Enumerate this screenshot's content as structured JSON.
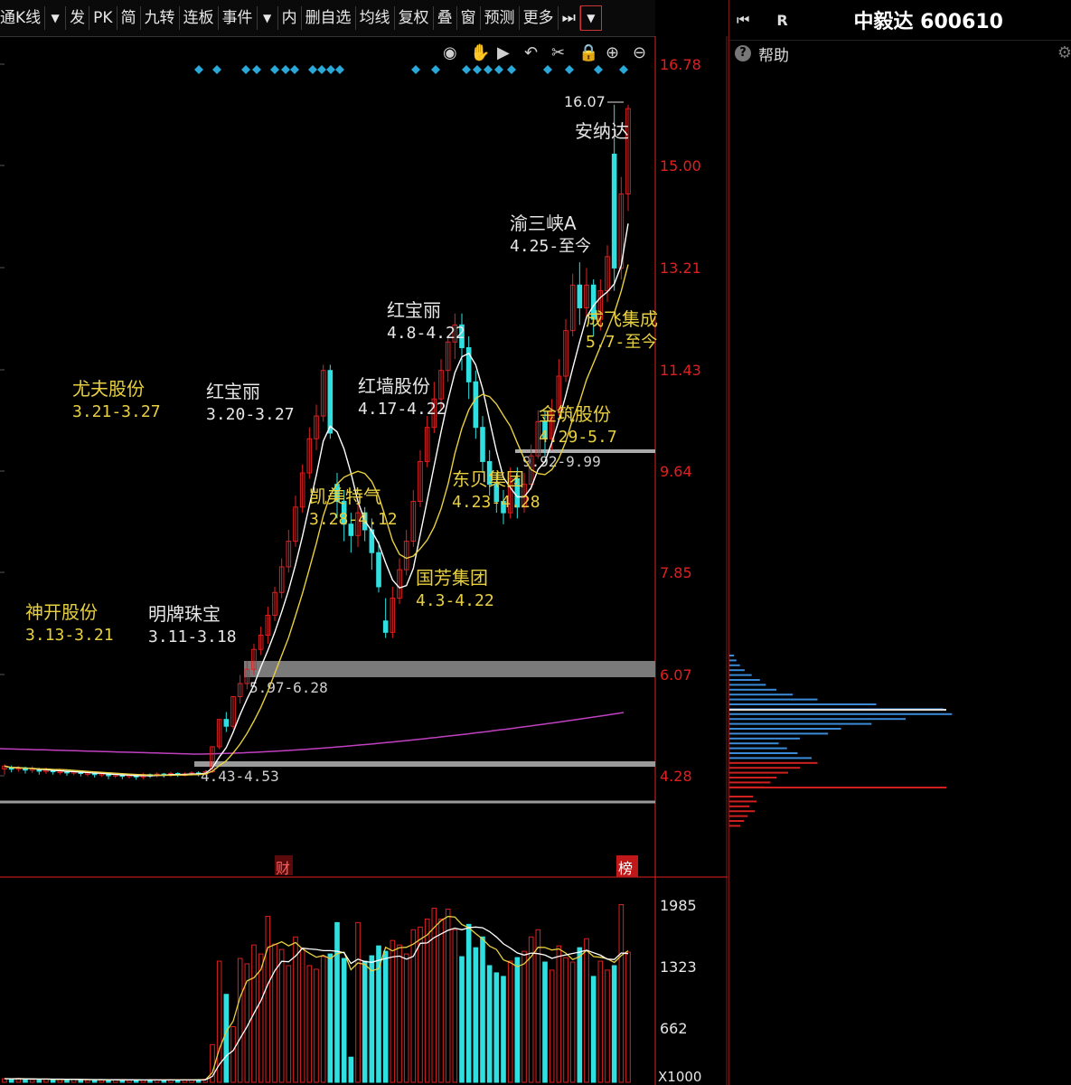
{
  "toolbar": {
    "items": [
      "通K线",
      "发",
      "PK",
      "简",
      "九转",
      "连板",
      "事件",
      "内",
      "删自选",
      "均线",
      "复权",
      "叠",
      "窗",
      "预测",
      "更多"
    ]
  },
  "stock": {
    "title": "中毅达 600610",
    "r_label": "R",
    "help": "帮助"
  },
  "colors": {
    "up": "#e02020",
    "down": "#30e0e0",
    "ma_white": "#ffffff",
    "ma_yellow": "#e8d040",
    "ma_magenta": "#c040c0",
    "annotation_yellow": "#e8d040",
    "annotation_white": "#e6e6e6",
    "axis_red": "#e02020",
    "diamond": "#2aa8d8"
  },
  "price_axis": [
    "16.78",
    "15.00",
    "13.21",
    "11.43",
    "9.64",
    "7.85",
    "6.07",
    "4.28"
  ],
  "volume_axis": [
    "1985",
    "1323",
    "662",
    "X1000"
  ],
  "markers": {
    "cai": "财",
    "bang": "榜"
  },
  "peak_label": "16.07",
  "annotations": [
    {
      "name": "神开股份",
      "range": "3.13-3.21",
      "color": "yellow"
    },
    {
      "name": "明牌珠宝",
      "range": "3.11-3.18",
      "color": "white"
    },
    {
      "name": "尤夫股份",
      "range": "3.21-3.27",
      "color": "yellow"
    },
    {
      "name": "红宝丽",
      "range": "3.20-3.27",
      "color": "white"
    },
    {
      "name": "凯美特气",
      "range": "3.28-4.12",
      "color": "yellow"
    },
    {
      "name": "红墙股份",
      "range": "4.17-4.22",
      "color": "white"
    },
    {
      "name": "红宝丽",
      "range": "4.8-4.22",
      "color": "white"
    },
    {
      "name": "国芳集团",
      "range": "4.3-4.22",
      "color": "yellow"
    },
    {
      "name": "东贝集团",
      "range": "4.23-4.28",
      "color": "yellow"
    },
    {
      "name": "金筑股份",
      "range": "4.29-5.7",
      "color": "yellow"
    },
    {
      "name": "渝三峡A",
      "range": "4.25-至今",
      "color": "white"
    },
    {
      "name": "成飞集成",
      "range": "5.7-至今",
      "color": "yellow"
    },
    {
      "name": "安纳达",
      "range": "",
      "color": "white"
    }
  ],
  "range_bands": [
    "5.97-6.28",
    "4.43-4.53",
    "9.92-9.99"
  ],
  "chart_data": {
    "type": "candlestick",
    "price_ylim": [
      3.5,
      17.0
    ],
    "volume_ylim": [
      0,
      2100
    ],
    "volume_unit": "X1000",
    "candles": [
      [
        4.4,
        4.45,
        4.3,
        4.48
      ],
      [
        4.42,
        4.4,
        4.34,
        4.46
      ],
      [
        4.4,
        4.42,
        4.35,
        4.45
      ],
      [
        4.42,
        4.38,
        4.32,
        4.44
      ],
      [
        4.38,
        4.4,
        4.33,
        4.45
      ],
      [
        4.4,
        4.36,
        4.3,
        4.42
      ],
      [
        4.36,
        4.38,
        4.31,
        4.42
      ],
      [
        4.38,
        4.35,
        4.3,
        4.4
      ],
      [
        4.35,
        4.36,
        4.3,
        4.4
      ],
      [
        4.36,
        4.33,
        4.28,
        4.38
      ],
      [
        4.33,
        4.35,
        4.29,
        4.38
      ],
      [
        4.35,
        4.32,
        4.27,
        4.37
      ],
      [
        4.32,
        4.33,
        4.27,
        4.36
      ],
      [
        4.33,
        4.3,
        4.25,
        4.35
      ],
      [
        4.3,
        4.32,
        4.26,
        4.35
      ],
      [
        4.32,
        4.28,
        4.22,
        4.34
      ],
      [
        4.28,
        4.3,
        4.24,
        4.33
      ],
      [
        4.3,
        4.27,
        4.22,
        4.32
      ],
      [
        4.27,
        4.29,
        4.23,
        4.32
      ],
      [
        4.29,
        4.26,
        4.21,
        4.31
      ],
      [
        4.26,
        4.3,
        4.22,
        4.33
      ],
      [
        4.3,
        4.28,
        4.24,
        4.32
      ],
      [
        4.28,
        4.31,
        4.25,
        4.34
      ],
      [
        4.31,
        4.29,
        4.25,
        4.33
      ],
      [
        4.29,
        4.32,
        4.26,
        4.35
      ],
      [
        4.32,
        4.3,
        4.26,
        4.34
      ],
      [
        4.3,
        4.31,
        4.27,
        4.34
      ],
      [
        4.31,
        4.33,
        4.28,
        4.36
      ],
      [
        4.33,
        4.31,
        4.27,
        4.36
      ],
      [
        4.31,
        4.35,
        4.29,
        4.38
      ],
      [
        4.35,
        4.79,
        4.33,
        4.79
      ],
      [
        4.79,
        5.27,
        4.75,
        5.27
      ],
      [
        5.27,
        5.15,
        5.05,
        5.4
      ],
      [
        5.15,
        5.67,
        5.1,
        5.67
      ],
      [
        5.67,
        5.9,
        5.55,
        6.05
      ],
      [
        5.9,
        6.15,
        5.8,
        6.3
      ],
      [
        6.15,
        6.5,
        6.05,
        6.6
      ],
      [
        6.5,
        6.75,
        6.4,
        6.9
      ],
      [
        6.75,
        7.1,
        6.6,
        7.25
      ],
      [
        7.1,
        7.5,
        7.0,
        7.6
      ],
      [
        7.5,
        7.95,
        7.4,
        8.1
      ],
      [
        7.95,
        8.4,
        7.85,
        8.6
      ],
      [
        8.4,
        9.0,
        8.3,
        9.2
      ],
      [
        9.0,
        9.6,
        8.9,
        9.75
      ],
      [
        9.6,
        10.2,
        9.5,
        10.4
      ],
      [
        10.2,
        10.6,
        10.0,
        10.8
      ],
      [
        10.6,
        11.4,
        10.5,
        11.5
      ],
      [
        11.4,
        10.3,
        10.2,
        11.5
      ],
      [
        9.4,
        9.1,
        8.8,
        9.6
      ],
      [
        9.1,
        8.7,
        8.4,
        9.3
      ],
      [
        8.7,
        8.5,
        8.2,
        8.9
      ],
      [
        8.5,
        8.9,
        8.3,
        9.1
      ],
      [
        8.9,
        8.6,
        8.4,
        9.0
      ],
      [
        8.6,
        8.2,
        7.9,
        8.8
      ],
      [
        8.2,
        7.6,
        7.5,
        8.4
      ],
      [
        7.0,
        6.8,
        6.7,
        7.4
      ],
      [
        6.8,
        7.4,
        6.7,
        7.6
      ],
      [
        7.4,
        7.9,
        7.3,
        8.1
      ],
      [
        7.9,
        8.4,
        7.8,
        8.6
      ],
      [
        8.4,
        9.1,
        8.3,
        9.3
      ],
      [
        9.1,
        9.8,
        9.0,
        10.0
      ],
      [
        9.8,
        10.4,
        9.7,
        10.6
      ],
      [
        10.4,
        10.9,
        10.3,
        11.2
      ],
      [
        10.9,
        11.4,
        10.7,
        11.6
      ],
      [
        11.4,
        11.9,
        11.2,
        12.0
      ],
      [
        11.9,
        12.2,
        11.6,
        12.4
      ],
      [
        12.2,
        11.8,
        11.4,
        12.4
      ],
      [
        11.8,
        11.2,
        10.9,
        12.0
      ],
      [
        11.2,
        10.4,
        10.2,
        11.4
      ],
      [
        10.4,
        9.8,
        9.6,
        10.6
      ],
      [
        9.8,
        9.4,
        9.2,
        10.0
      ],
      [
        9.4,
        9.1,
        8.9,
        9.6
      ],
      [
        9.1,
        8.9,
        8.7,
        9.3
      ],
      [
        8.9,
        9.5,
        8.8,
        9.7
      ],
      [
        9.5,
        9.0,
        8.8,
        9.7
      ],
      [
        9.0,
        9.4,
        8.9,
        9.6
      ],
      [
        9.4,
        9.9,
        9.3,
        10.1
      ],
      [
        9.9,
        10.5,
        9.85,
        10.7
      ],
      [
        10.5,
        10.2,
        9.9,
        10.7
      ],
      [
        10.2,
        10.7,
        10.0,
        10.9
      ],
      [
        10.7,
        11.3,
        10.6,
        11.6
      ],
      [
        11.3,
        12.1,
        11.2,
        12.3
      ],
      [
        12.1,
        12.9,
        12.0,
        13.1
      ],
      [
        12.9,
        12.5,
        12.2,
        13.3
      ],
      [
        12.5,
        12.9,
        12.3,
        13.2
      ],
      [
        12.9,
        12.3,
        12.0,
        13.0
      ],
      [
        12.3,
        12.8,
        12.1,
        13.0
      ],
      [
        12.8,
        13.4,
        12.6,
        13.6
      ],
      [
        15.2,
        13.2,
        12.8,
        16.07
      ],
      [
        13.2,
        14.5,
        13.0,
        14.8
      ],
      [
        14.5,
        16.0,
        14.2,
        16.07
      ]
    ],
    "volumes": [
      40,
      38,
      42,
      35,
      30,
      33,
      36,
      32,
      30,
      28,
      31,
      29,
      27,
      30,
      26,
      28,
      25,
      27,
      24,
      26,
      25,
      28,
      26,
      24,
      27,
      25,
      28,
      26,
      30,
      35,
      420,
      1350,
      980,
      620,
      1380,
      1320,
      1530,
      1430,
      1850,
      1540,
      1480,
      1300,
      1620,
      1490,
      1300,
      1260,
      1400,
      1430,
      1780,
      1380,
      280,
      1780,
      1350,
      1410,
      1520,
      1460,
      1580,
      1530,
      1430,
      1700,
      1730,
      1820,
      1940,
      1820,
      1930,
      1700,
      1400,
      1760,
      1500,
      1620,
      1300,
      1220,
      1180,
      1350,
      1390,
      1460,
      1620,
      1700,
      1340,
      1250,
      1520,
      1390,
      1340,
      1500,
      1600,
      1180,
      1350,
      1250,
      1300,
      1980,
      1450
    ]
  }
}
